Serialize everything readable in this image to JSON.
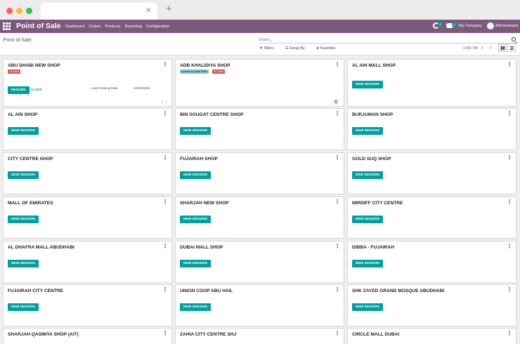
{
  "browser": {
    "tab_close": "×",
    "new_tab": "+"
  },
  "navbar": {
    "brand": "Point of Sale",
    "menu": [
      "Dashboard",
      "Orders",
      "Products",
      "Reporting",
      "Configuration"
    ],
    "chat_count": "2",
    "activity_count": "4",
    "company": "My Company",
    "user": "Administrator"
  },
  "control": {
    "breadcrumb": "Point of Sale",
    "search_placeholder": "Search...",
    "filters": "Filters",
    "group_by": "Group By",
    "favorites": "Favorites",
    "pager": "1-54 / 54"
  },
  "shops": [
    {
      "name": "ABU DHABI NEW SHOP",
      "tags": [
        "To Close"
      ],
      "primary": "RESUME",
      "secondary": "CLOSE",
      "meta_label": "Last Closing Date",
      "meta_value": "10/13/2021"
    },
    {
      "name": "ADB KHALIDIYA SHOP",
      "tags": [
        "Opened by Aynal Team",
        "To Close"
      ]
    },
    {
      "name": "AL AIN MALL SHOP",
      "primary": "NEW SESSION"
    },
    {
      "name": "AL AIN SHOP",
      "primary": "NEW SESSION"
    },
    {
      "name": "BIN SOUGAT CENTRE SHOP",
      "primary": "NEW SESSION"
    },
    {
      "name": "BURJUMAN SHOP",
      "primary": "NEW SESSION"
    },
    {
      "name": "CITY CENTRE SHOP",
      "primary": "NEW SESSION"
    },
    {
      "name": "FUJAIRAH SHOP",
      "primary": "NEW SESSION"
    },
    {
      "name": "GOLD SUQ SHOP",
      "primary": "NEW SESSION"
    },
    {
      "name": "MALL OF EMIRATES",
      "primary": "NEW SESSION"
    },
    {
      "name": "SHARJAH NEW SHOP",
      "primary": "NEW SESSION"
    },
    {
      "name": "MIRDIFF CITY CENTRE",
      "primary": "NEW SESSION"
    },
    {
      "name": "AL DHAFRA MALL ABUDHABI",
      "primary": "NEW SESSION"
    },
    {
      "name": "DUBAI MALL SHOP",
      "primary": "NEW SESSION"
    },
    {
      "name": "DIBBA - FUJAIRAH",
      "primary": "NEW SESSION"
    },
    {
      "name": "FUJAIRAH CITY CENTRE",
      "primary": "NEW SESSION"
    },
    {
      "name": "UNION COOP ABU HAIL",
      "primary": "NEW SESSION"
    },
    {
      "name": "SHK ZAYED GRAND MOSQUE ABUDHABI",
      "primary": "NEW SESSION"
    },
    {
      "name": "SHARJAH QASMIYA SHOP (AIT)"
    },
    {
      "name": "ZAHIA CITY CENTRE SHJ"
    },
    {
      "name": "CIRCLE MALL DUBAI"
    }
  ],
  "colors": {
    "navbar": "#7c5a7c",
    "primary_button": "#00a09d",
    "to_close_tag": "#d9534f",
    "opened_tag": "#85c4d8"
  },
  "icons": [
    "apps-icon",
    "chat-icon",
    "activity-icon",
    "user-avatar",
    "search-icon",
    "filter-icon",
    "group-by-icon",
    "star-icon",
    "kanban-view-icon",
    "list-view-icon",
    "card-menu-icon"
  ]
}
